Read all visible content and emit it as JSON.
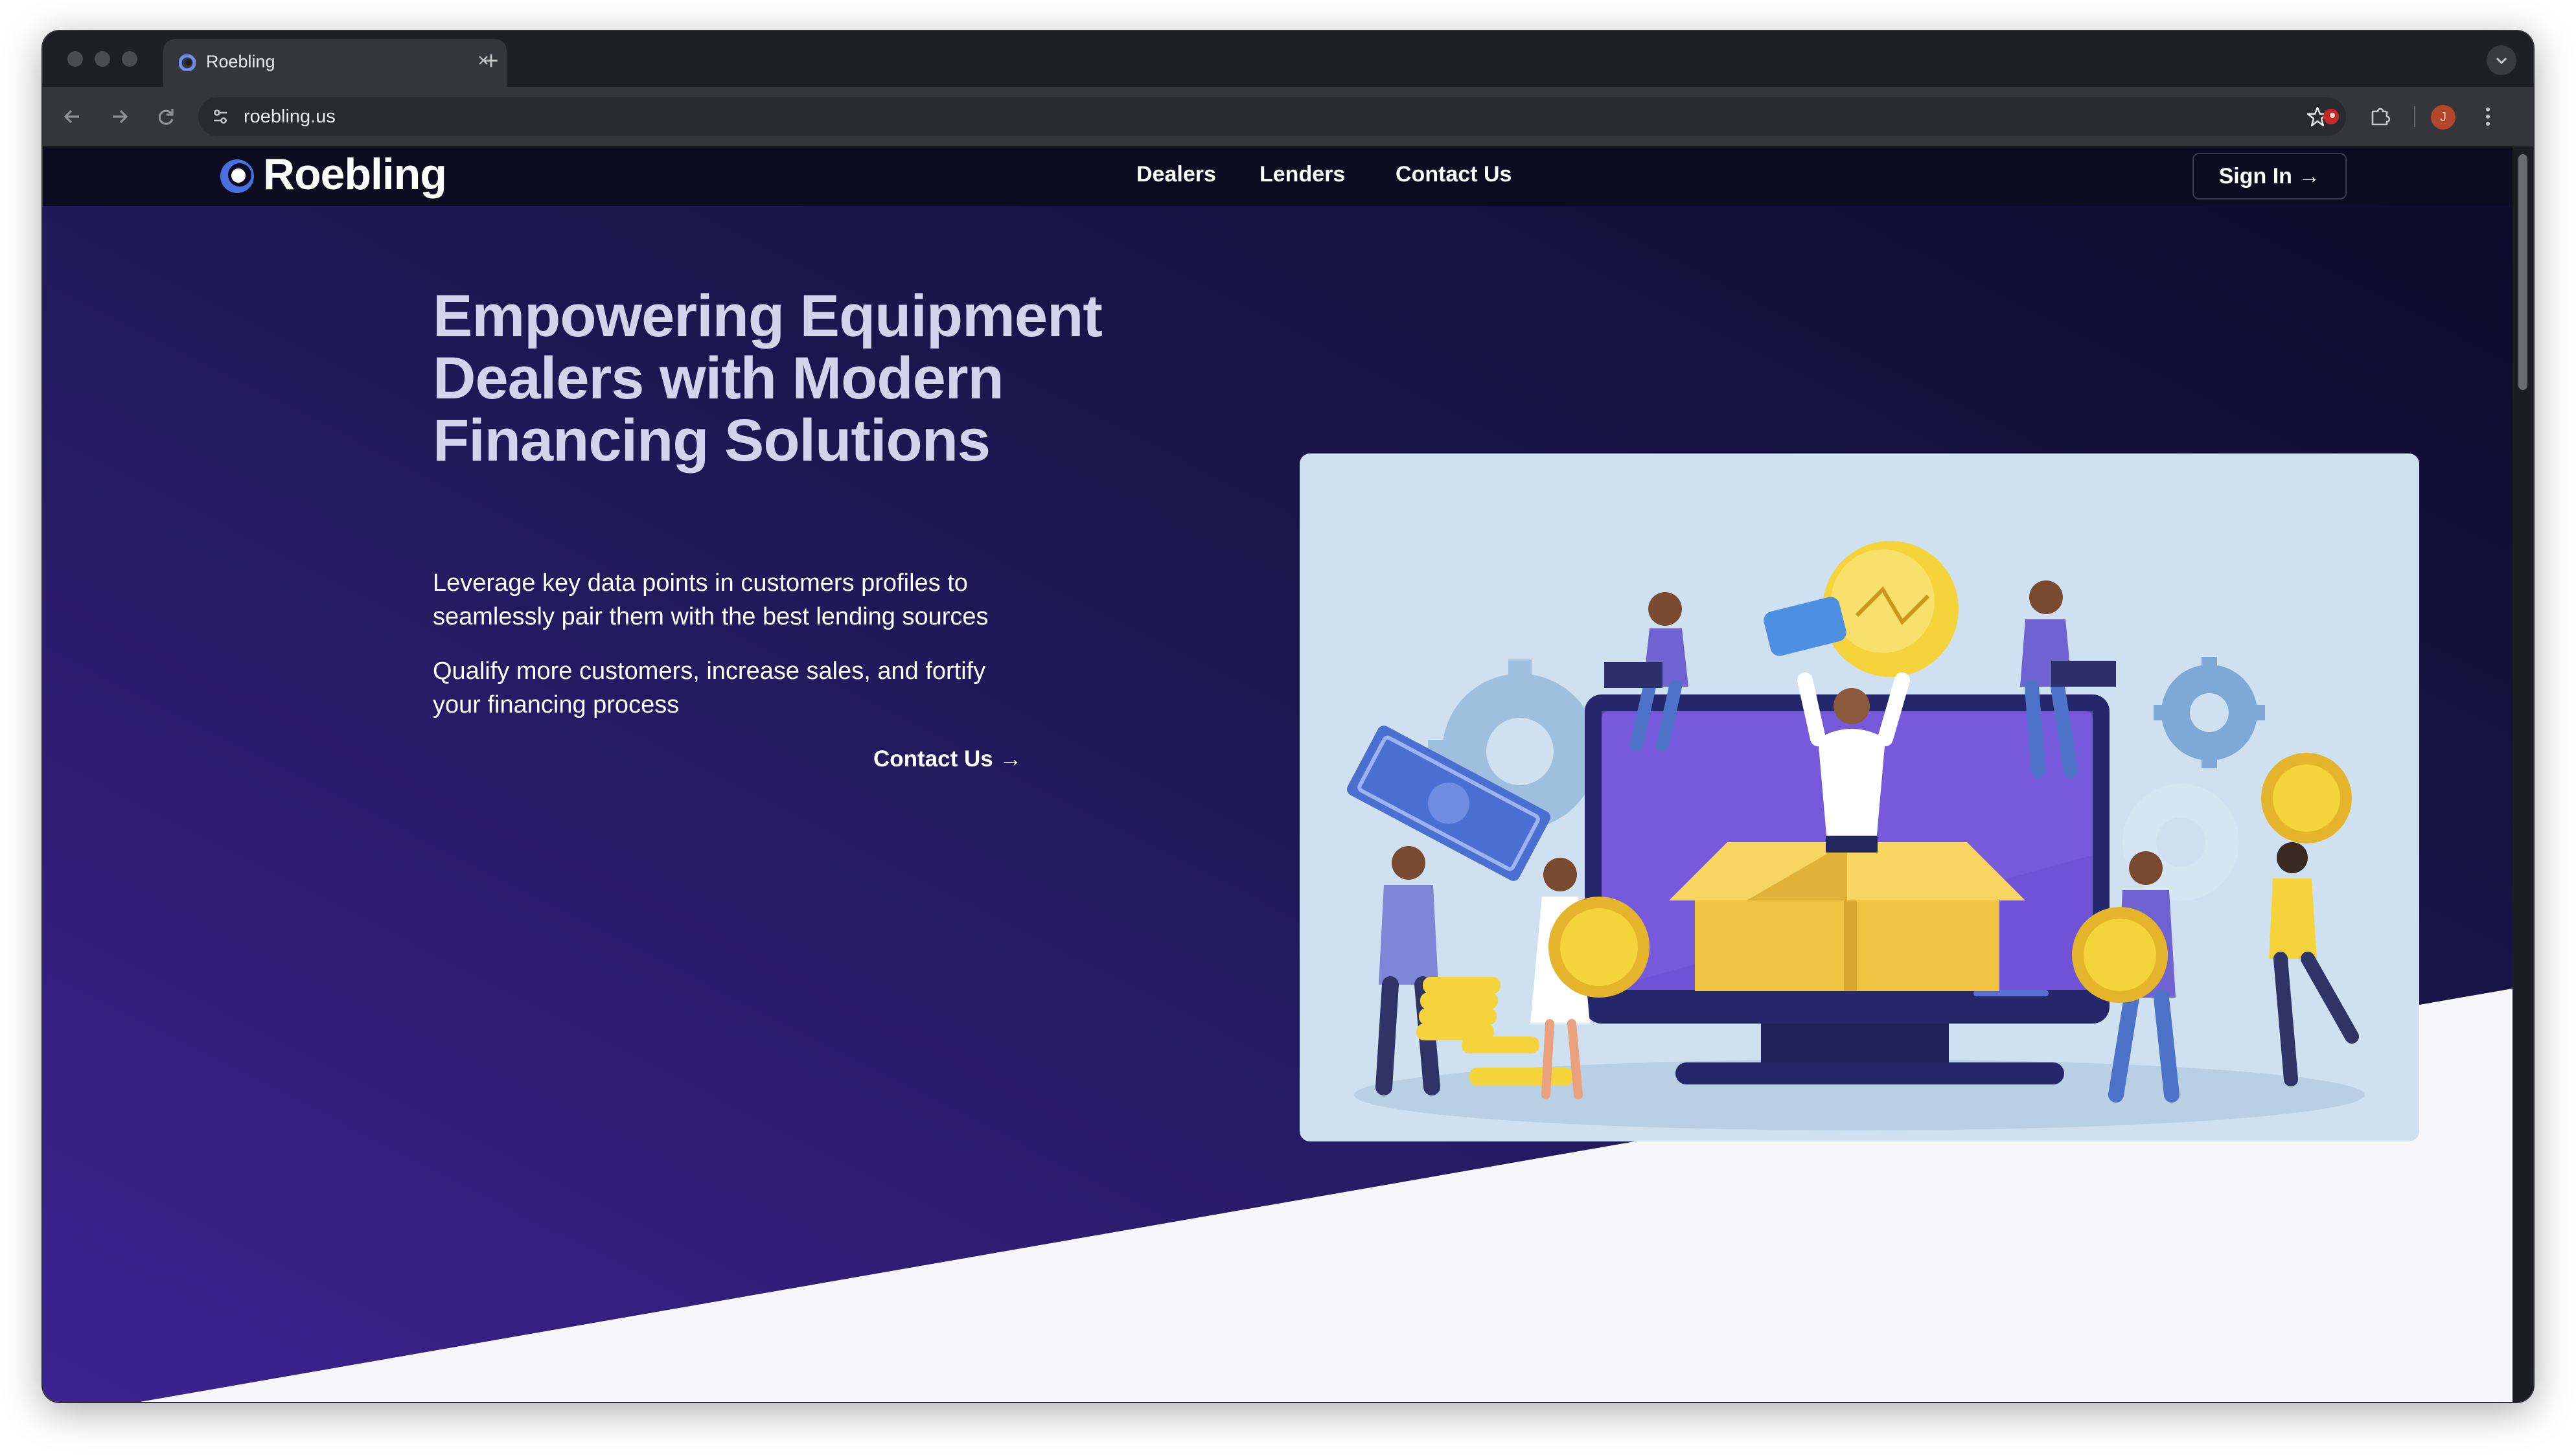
{
  "browser": {
    "tab_title": "Roebling",
    "new_tab_label": "+",
    "close_tab_label": "×",
    "url": "roebling.us",
    "profile_initial": "J"
  },
  "site": {
    "logo_text": "Roebling",
    "nav": {
      "dealers": "Dealers",
      "lenders": "Lenders",
      "contact": "Contact Us",
      "sign_in": "Sign In →"
    },
    "hero": {
      "title_line1": "Empowering Equipment",
      "title_line2": "Dealers with Modern",
      "title_line3": "Financing Solutions",
      "para1_line1": "Leverage key data points in customers profiles to",
      "para1_line2": "seamlessly pair them with the best lending sources",
      "para2_line1": "Qualify more customers, increase sales, and fortify",
      "para2_line2": "your financing process",
      "cta": "Contact Us →"
    }
  },
  "colors": {
    "nav_bg": "#0c0b20",
    "hero_dark": "#16123d",
    "hero_purple": "#3a2590",
    "title": "#d4d3ec",
    "illustration_bg": "#cfe1f0",
    "accent_gold": "#f5d33b"
  }
}
